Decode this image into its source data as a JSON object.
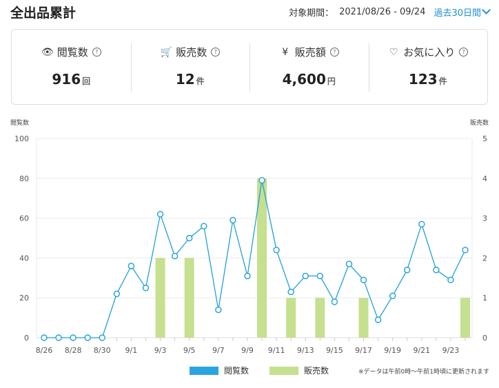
{
  "header": {
    "title": "全出品累計",
    "period_label": "対象期間：",
    "period_dates": "2021/08/26 - 09/24",
    "range_select": "過去30日間"
  },
  "stats": [
    {
      "icon": "eye-icon",
      "glyph": "👁",
      "label": "閲覧数",
      "value": "916",
      "unit": "回"
    },
    {
      "icon": "cart-icon",
      "glyph": "🛒",
      "label": "販売数",
      "value": "12",
      "unit": "件"
    },
    {
      "icon": "yen-icon",
      "glyph": "¥",
      "label": "販売額",
      "value": "4,600",
      "unit": "円"
    },
    {
      "icon": "heart-icon",
      "glyph": "♡",
      "label": "お気に入り",
      "value": "123",
      "unit": "件"
    }
  ],
  "chart_data": {
    "type": "bar+line",
    "y_left_label": "閲覧数",
    "y_right_label": "販売数",
    "ylim_left": [
      0,
      100
    ],
    "ylim_right": [
      0,
      5
    ],
    "y_left_ticks": [
      "0",
      "20",
      "40",
      "60",
      "80",
      "100"
    ],
    "y_right_ticks": [
      "0",
      "1",
      "2",
      "3",
      "4",
      "5"
    ],
    "categories": [
      "8/26",
      "8/27",
      "8/28",
      "8/29",
      "8/30",
      "8/31",
      "9/1",
      "9/2",
      "9/3",
      "9/4",
      "9/5",
      "9/6",
      "9/7",
      "9/8",
      "9/9",
      "9/10",
      "9/11",
      "9/12",
      "9/13",
      "9/14",
      "9/15",
      "9/16",
      "9/17",
      "9/18",
      "9/19",
      "9/20",
      "9/21",
      "9/22",
      "9/23",
      "9/24"
    ],
    "x_tick_labels": [
      "8/26",
      "8/28",
      "8/30",
      "9/1",
      "9/3",
      "9/5",
      "9/7",
      "9/9",
      "9/11",
      "9/13",
      "9/15",
      "9/17",
      "9/19",
      "9/21",
      "9/23"
    ],
    "series": [
      {
        "name": "閲覧数",
        "type": "line",
        "axis": "left",
        "color": "#1ea0dc",
        "values": [
          0,
          0,
          0,
          0,
          0,
          22,
          36,
          25,
          62,
          41,
          50,
          56,
          14,
          59,
          31,
          79,
          44,
          23,
          31,
          31,
          18,
          37,
          29,
          9,
          21,
          34,
          57,
          34,
          29,
          44
        ]
      },
      {
        "name": "販売数",
        "type": "bar",
        "axis": "right",
        "color": "#c5e08f",
        "values": [
          0,
          0,
          0,
          0,
          0,
          0,
          0,
          0,
          2,
          0,
          2,
          0,
          0,
          0,
          0,
          4,
          0,
          1,
          0,
          1,
          0,
          0,
          1,
          0,
          0,
          0,
          0,
          0,
          0,
          1
        ]
      }
    ],
    "legend": [
      {
        "name": "閲覧数",
        "color": "#2ba4e0"
      },
      {
        "name": "販売数",
        "color": "#c5e08f"
      }
    ],
    "note": "※データは午前0時〜午前1時頃に更新されます"
  }
}
